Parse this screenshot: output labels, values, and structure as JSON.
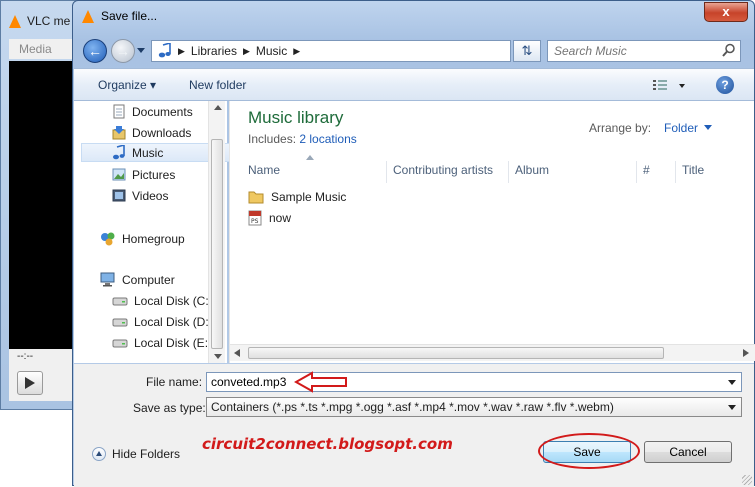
{
  "vlc": {
    "title": "VLC me",
    "menu": "Media",
    "time": "--:--"
  },
  "dialog": {
    "title": "Save file...",
    "close_label": "x"
  },
  "address": {
    "crumbs": [
      "Libraries",
      "Music"
    ],
    "search_placeholder": "Search Music"
  },
  "toolbar": {
    "organize": "Organize",
    "new_folder": "New folder",
    "help": "?"
  },
  "nav": {
    "items": [
      {
        "label": "Documents",
        "icon": "documents-icon"
      },
      {
        "label": "Downloads",
        "icon": "downloads-icon"
      },
      {
        "label": "Music",
        "icon": "music-icon",
        "selected": true
      },
      {
        "label": "Pictures",
        "icon": "pictures-icon"
      },
      {
        "label": "Videos",
        "icon": "videos-icon"
      },
      {
        "label": "Homegroup",
        "icon": "homegroup-icon"
      },
      {
        "label": "Computer",
        "icon": "computer-icon"
      },
      {
        "label": "Local Disk (C:)",
        "icon": "drive-icon"
      },
      {
        "label": "Local Disk (D:)",
        "icon": "drive-icon"
      },
      {
        "label": "Local Disk (E:)",
        "icon": "drive-icon"
      }
    ]
  },
  "library": {
    "title": "Music library",
    "includes_label": "Includes:",
    "includes_link": "2 locations",
    "arrange_label": "Arrange by:",
    "arrange_value": "Folder"
  },
  "columns": [
    "Name",
    "Contributing artists",
    "Album",
    "#",
    "Title"
  ],
  "files": [
    {
      "name": "Sample Music",
      "icon": "folder-icon"
    },
    {
      "name": "now",
      "icon": "postscript-file-icon"
    }
  ],
  "form": {
    "filename_label": "File name:",
    "filename_value": "conveted.mp3",
    "savetype_label": "Save as type:",
    "savetype_value": "Containers (*.ps *.ts *.mpg *.ogg *.asf *.mp4 *.mov *.wav *.raw *.flv *.webm)",
    "hide_folders": "Hide Folders",
    "save": "Save",
    "cancel": "Cancel"
  },
  "watermark": "circuit2connect.blogsopt.com",
  "colors": {
    "annotation_red": "#d21a1a",
    "library_green": "#1e6b3a",
    "link_blue": "#1f5db8"
  }
}
